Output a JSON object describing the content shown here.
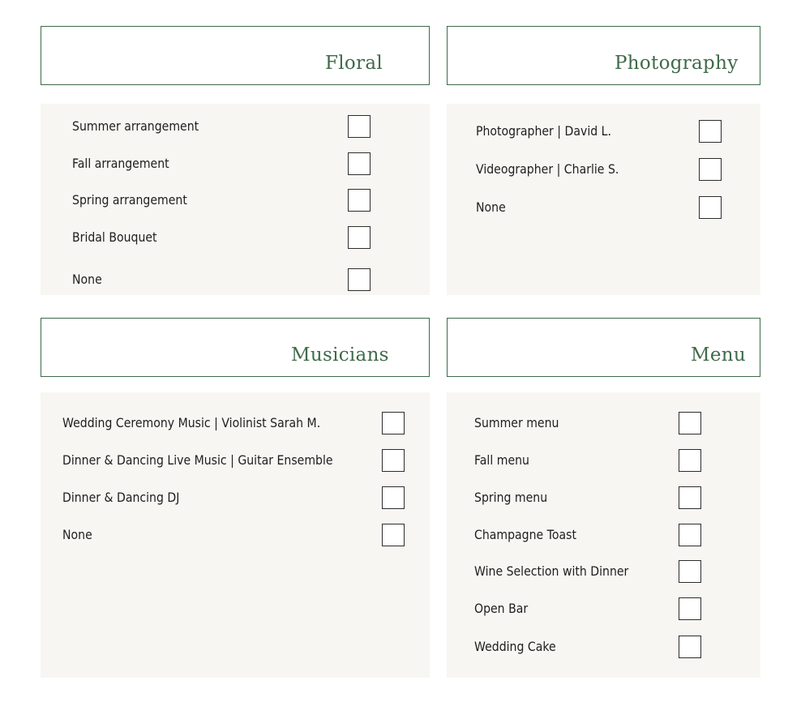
{
  "floral": {
    "title": "Floral",
    "options": [
      "Summer arrangement",
      "Fall arrangement",
      "Spring arrangement",
      "Bridal Bouquet",
      "None"
    ]
  },
  "photography": {
    "title": "Photography",
    "options": [
      "Photographer |  David L.",
      "Videographer |  Charlie S.",
      "None"
    ]
  },
  "musicians": {
    "title": "Musicians",
    "options": [
      "Wedding Ceremony Music | Violinist Sarah M.",
      "Dinner & Dancing Live Music | Guitar Ensemble",
      "Dinner & Dancing DJ",
      "None"
    ]
  },
  "menu": {
    "title": "Menu",
    "options": [
      "Summer menu",
      "Fall menu",
      "Spring menu",
      "Champagne Toast",
      "Wine Selection with Dinner",
      "Open Bar",
      "Wedding Cake"
    ]
  }
}
